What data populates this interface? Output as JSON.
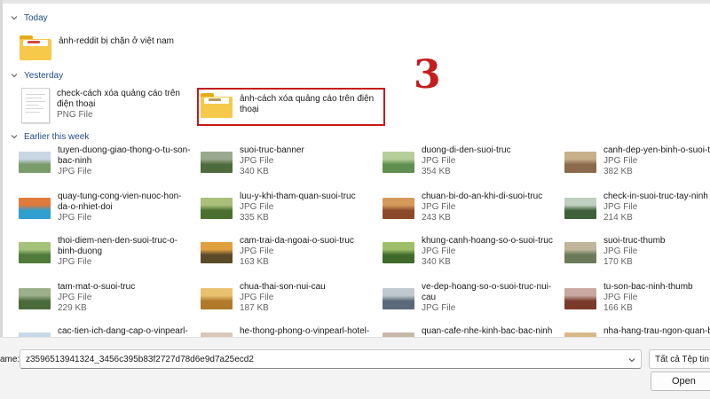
{
  "groups": {
    "today": "Today",
    "yesterday": "Yesterday",
    "earlier": "Earlier this week"
  },
  "today_items": [
    {
      "name": "ảnh-reddit bị chặn ở việt nam",
      "icon": "folder-icon"
    }
  ],
  "yesterday_items": [
    {
      "name": "check-cách xóa quảng cáo trên điện thoại",
      "type": "PNG File",
      "icon": "png-file-icon"
    },
    {
      "name": "ảnh-cách xóa quảng cáo trên điện thoại",
      "icon": "folder-icon"
    }
  ],
  "earlier_items": [
    {
      "name": "tuyen-duong-giao-thong-o-tu-son-bac-ninh",
      "type": "JPG File",
      "size": "",
      "thumb": [
        "#7a9b6a",
        "#c9d6e3"
      ]
    },
    {
      "name": "suoi-truc-banner",
      "type": "JPG File",
      "size": "340 KB",
      "thumb": [
        "#4e6b3d",
        "#9aa98e"
      ]
    },
    {
      "name": "duong-di-den-suoi-truc",
      "type": "JPG File",
      "size": "354 KB",
      "thumb": [
        "#5f8f4e",
        "#b6cf9a"
      ]
    },
    {
      "name": "canh-dep-yen-binh-o-suoi-tr",
      "type": "JPG File",
      "size": "382 KB",
      "thumb": [
        "#8a6a4a",
        "#c8b08a"
      ]
    },
    {
      "name": "quay-tung-cong-vien-nuoc-hon-da-o-nhiet-doi",
      "type": "JPG File",
      "size": "",
      "thumb": [
        "#2f9fd0",
        "#e07a3a"
      ]
    },
    {
      "name": "luu-y-khi-tham-quan-suoi-truc",
      "type": "JPG File",
      "size": "335 KB",
      "thumb": [
        "#4b6f2e",
        "#a9bf7a"
      ]
    },
    {
      "name": "chuan-bi-do-an-khi-di-suoi-truc",
      "type": "JPG File",
      "size": "243 KB",
      "thumb": [
        "#8a4a2a",
        "#d49a5a"
      ]
    },
    {
      "name": "check-in-suoi-truc-tay-ninh",
      "type": "JPG File",
      "size": "214 KB",
      "thumb": [
        "#3f5f3a",
        "#bfcfc0"
      ]
    },
    {
      "name": "thoi-diem-nen-den-suoi-truc-o-binh-duong",
      "type": "JPG File",
      "size": "",
      "thumb": [
        "#4f7a3a",
        "#a5c27a"
      ]
    },
    {
      "name": "cam-trai-da-ngoai-o-suoi-truc",
      "type": "JPG File",
      "size": "163 KB",
      "thumb": [
        "#5a4a2a",
        "#e0a040"
      ]
    },
    {
      "name": "khung-canh-hoang-so-o-suoi-truc",
      "type": "JPG File",
      "size": "340 KB",
      "thumb": [
        "#3f6a2a",
        "#9fbf6a"
      ]
    },
    {
      "name": "suoi-truc-thumb",
      "type": "JPG File",
      "size": "170 KB",
      "thumb": [
        "#6a7a5a",
        "#bfb59a"
      ]
    },
    {
      "name": "tam-mat-o-suoi-truc",
      "type": "JPG File",
      "size": "229 KB",
      "thumb": [
        "#4a6a3a",
        "#9aaf8a"
      ]
    },
    {
      "name": "chua-thai-son-nui-cau",
      "type": "JPG File",
      "size": "187 KB",
      "thumb": [
        "#b07a2a",
        "#e8c070"
      ]
    },
    {
      "name": "ve-dep-hoang-so-o-suoi-truc-nui-cau",
      "type": "JPG File",
      "size": "",
      "thumb": [
        "#5a6a7a",
        "#c0c8d0"
      ]
    },
    {
      "name": "tu-son-bac-ninh-thumb",
      "type": "JPG File",
      "size": "166 KB",
      "thumb": [
        "#7a3a2a",
        "#c8a8a0"
      ]
    },
    {
      "name": "cac-tien-ich-dang-cap-o-vinpearl-h",
      "type": "",
      "size": "",
      "thumb": [
        "#6a8aa8",
        "#c8d8e8"
      ]
    },
    {
      "name": "he-thong-phong-o-vinpearl-hotel-",
      "type": "",
      "size": "",
      "thumb": [
        "#8a7a6a",
        "#d8c8b8"
      ]
    },
    {
      "name": "quan-cafe-nhe-kinh-bac-bac-ninh",
      "type": "",
      "size": "",
      "thumb": [
        "#6a5a4a",
        "#c8b8a8"
      ]
    },
    {
      "name": "nha-hang-trau-ngon-quan-bac",
      "type": "",
      "size": "",
      "thumb": [
        "#8a6a3a",
        "#d8b888"
      ]
    }
  ],
  "annotation": "3",
  "bottom": {
    "file_name_label": "ame:",
    "file_name_value": "z3596513941324_3456c395b83f2727d78d6e9d7a25ecd2",
    "file_type": "Tất cả Tệp tin",
    "open_label": "Open"
  },
  "colors": {
    "group_header": "#1f4a8a",
    "highlight": "#c61a1a",
    "folder": "#f6c94b"
  }
}
